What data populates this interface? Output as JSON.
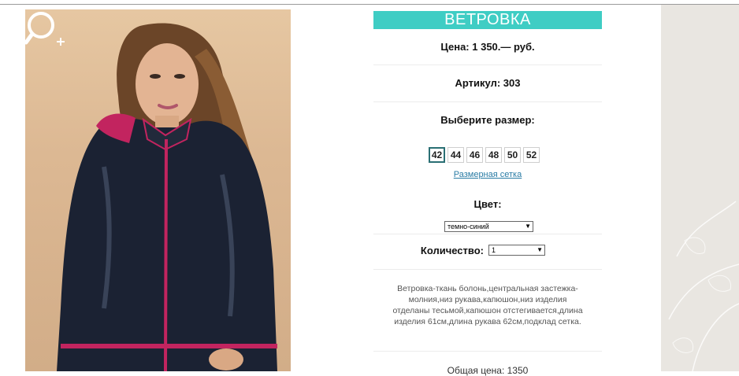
{
  "product": {
    "title": "ВЕТРОВКА",
    "price": "Цена: 1 350.— руб.",
    "sku": "Артикул: 303",
    "choose_size_label": "Выберите размер:",
    "sizes": [
      "42",
      "44",
      "46",
      "48",
      "50",
      "52"
    ],
    "selected_size": "42",
    "size_chart_link": "Размерная сетка",
    "color_label": "Цвет:",
    "color_selected": "темно-синий",
    "quantity_label": "Количество:",
    "quantity_selected": "1",
    "description": "Ветровка-ткань болонь,центральная застежка-молния,низ рукава,капюшон,низ изделия отделаны тесьмой,капюшон отстегивается,длина изделия 61см,длина рукава 62см,подклад сетка.",
    "total": "Общая цена: 1350"
  },
  "icons": {
    "zoom": "zoom-in-icon"
  },
  "colors": {
    "title_bar": "#3fcdc4",
    "link": "#2a7ca5",
    "side_panel": "#e9e6e1"
  }
}
